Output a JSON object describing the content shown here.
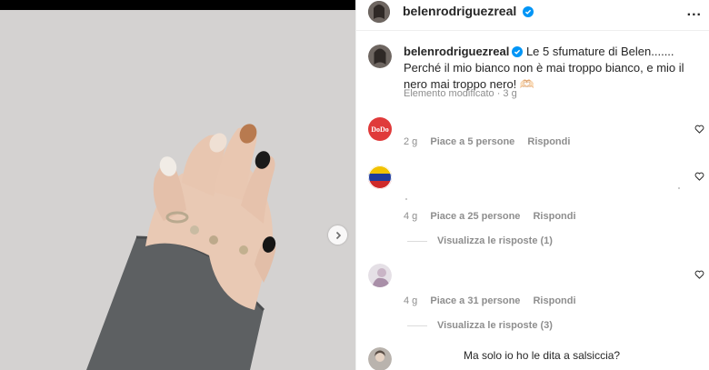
{
  "post": {
    "author": "belenrodriguezreal",
    "caption_author": "belenrodriguezreal",
    "caption_text": "Le 5 sfumature di Belen....... Perché il mio bianco non è mai troppo bianco, e mio il nero mai troppo nero! 🫶🏻",
    "caption_meta": "Elemento modificato · 3 g",
    "more_label": "..."
  },
  "comments": [
    {
      "avatar": "dodo-logo",
      "avatar_text": "DoDo",
      "age": "2 g",
      "likes": "Piace a 5 persone",
      "reply": "Rispondi"
    },
    {
      "avatar": "venezuela-flag",
      "age": "4 g",
      "likes": "Piace a 25 persone",
      "reply": "Rispondi",
      "view_replies": "Visualizza le risposte (1)"
    },
    {
      "avatar": "user-photo",
      "age": "4 g",
      "likes": "Piace a 31 persone",
      "reply": "Rispondi",
      "view_replies": "Visualizza le risposte (3)"
    },
    {
      "avatar": "user-photo",
      "text": "Ma solo io ho le dita a salsiccia?"
    }
  ],
  "colors": {
    "accent": "#0095f6",
    "muted": "#8e8e8e",
    "dodo_red": "#e03a3a"
  },
  "icons": [
    "verified-badge-icon",
    "heart-icon",
    "chevron-right-icon",
    "more-options-icon"
  ]
}
